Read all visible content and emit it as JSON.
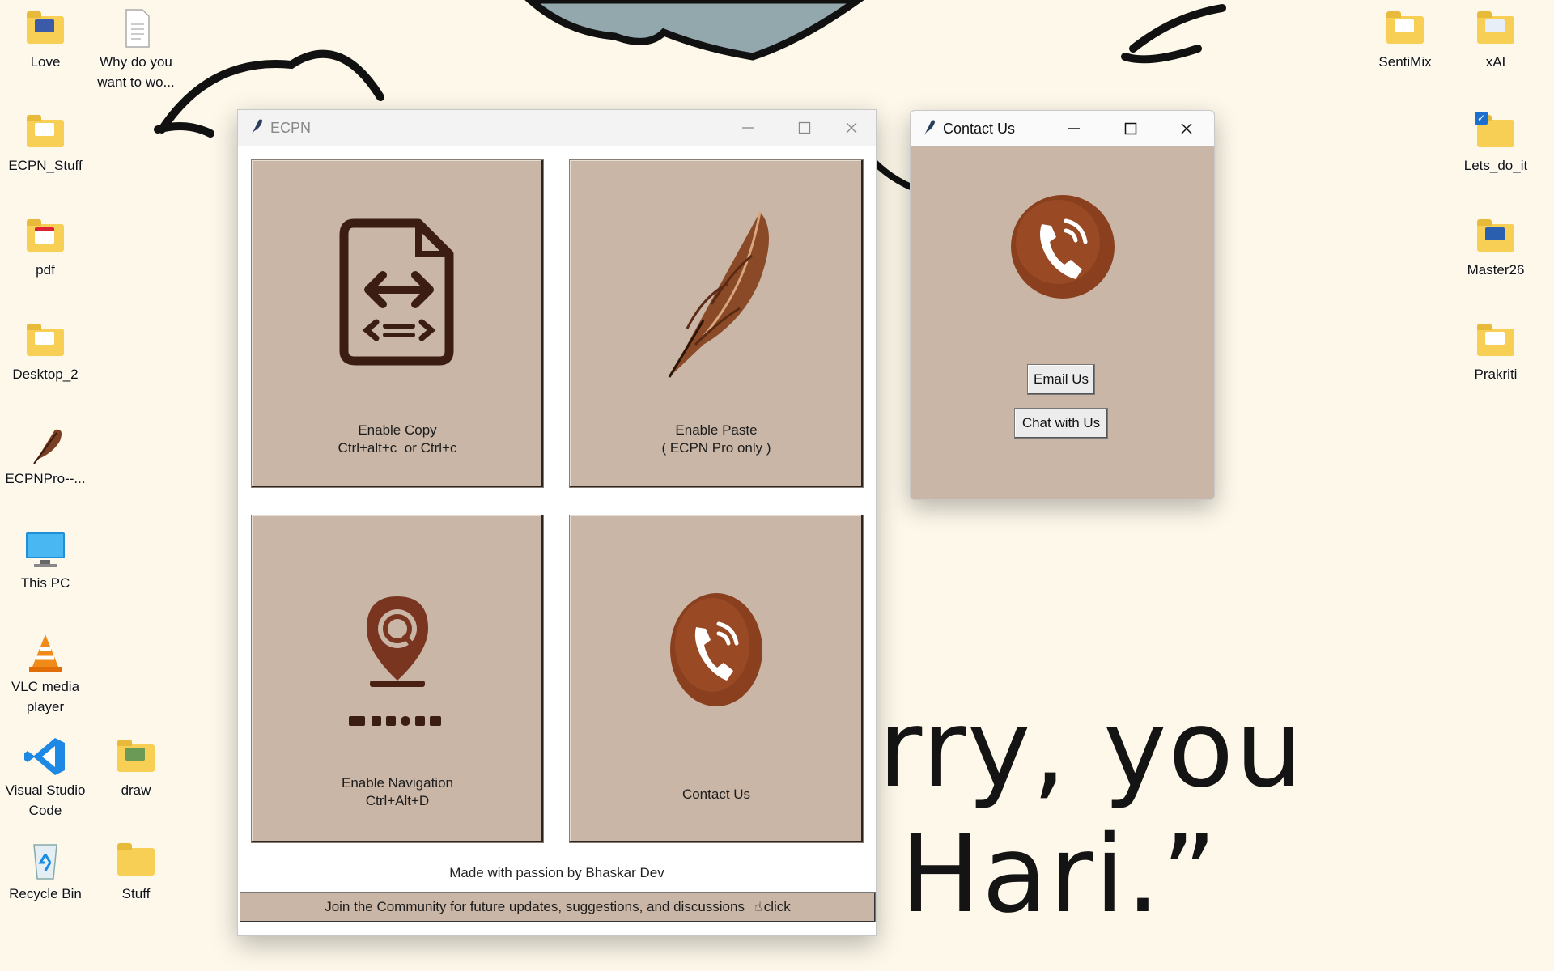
{
  "desktop": {
    "left_icons": [
      {
        "label": "Love"
      },
      {
        "label": "Why do you\nwant to wo..."
      },
      {
        "label": "ECPN_Stuff"
      },
      {
        "label": "pdf"
      },
      {
        "label": "Desktop_2"
      },
      {
        "label": "ECPNPro--..."
      },
      {
        "label": "This PC"
      },
      {
        "label": "VLC media\nplayer"
      },
      {
        "label": "Visual Studio\nCode"
      },
      {
        "label": "draw"
      },
      {
        "label": "Recycle Bin"
      },
      {
        "label": "Stuff"
      }
    ],
    "right_icons": [
      {
        "label": "SentiMix"
      },
      {
        "label": "xAI"
      },
      {
        "label": "Lets_do_it"
      },
      {
        "label": "Master26"
      },
      {
        "label": "Prakriti"
      }
    ],
    "wallpaper_text": {
      "line1": "rry, you",
      "line2": "Hari.”"
    }
  },
  "ecpn_window": {
    "title": "ECPN",
    "tiles": {
      "copy": {
        "line1": "Enable Copy",
        "line2": "Ctrl+alt+c  or Ctrl+c"
      },
      "paste": {
        "line1": "Enable Paste",
        "line2": "( ECPN Pro only )"
      },
      "navigation": {
        "line1": "Enable Navigation",
        "line2": "Ctrl+Alt+D"
      },
      "contact": {
        "line1": "Contact Us"
      }
    },
    "footer_credit": "Made with passion by Bhaskar Dev",
    "community_bar": {
      "text": "Join the Community for future updates, suggestions, and discussions",
      "link": "click"
    }
  },
  "contact_window": {
    "title": "Contact Us",
    "email_button": "Email Us",
    "chat_button": "Chat with Us"
  },
  "colors": {
    "tile_bg": "#c9b6a6",
    "accent_brown": "#8a3f1e",
    "icon_dark": "#3b1d14"
  }
}
